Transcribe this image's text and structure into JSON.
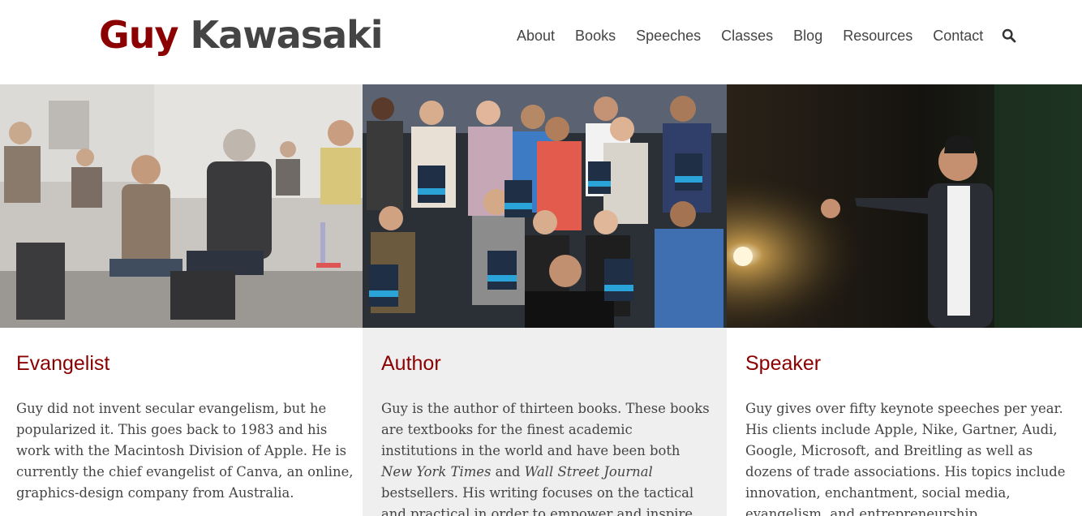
{
  "brand": {
    "first": "Guy",
    "last": "Kawasaki"
  },
  "nav": {
    "items": [
      "About",
      "Books",
      "Speeches",
      "Classes",
      "Blog",
      "Resources",
      "Contact"
    ],
    "search_icon": "search-icon"
  },
  "columns": [
    {
      "title": "Evangelist",
      "body": "Guy did not invent secular evangelism, but he popularized it. This goes back to 1983 and his work with the Macintosh Division of Apple. He is currently the chief evangelist of Canva, an online, graphics-design company from Australia."
    },
    {
      "title": "Author",
      "body_parts": [
        "Guy is the author of thirteen books. These books are textbooks for the finest academic institutions in the world and have been both ",
        "New York Times",
        " and ",
        "Wall Street Journal",
        " bestsellers. His writing focuses on the tactical and practical in order to empower and inspire."
      ]
    },
    {
      "title": "Speaker",
      "body": "Guy gives over fifty keynote speeches per year. His clients include Apple, Nike, Gartner, Audi, Google, Microsoft, and Breitling as well as dozens of trade associations. His topics include innovation, enchantment, social media, evangelism, and entrepreneurship."
    }
  ],
  "colors": {
    "brand_red": "#8b0000",
    "text": "#444444",
    "panel_gray": "#efefef"
  }
}
